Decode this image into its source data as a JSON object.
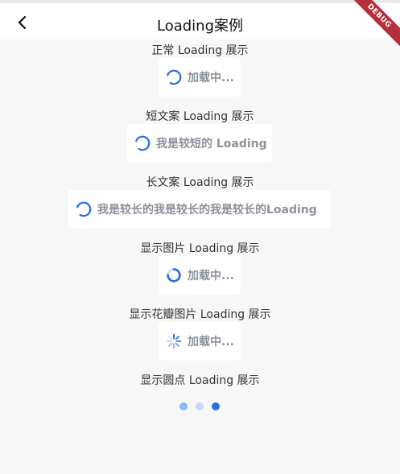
{
  "appbar": {
    "title": "Loading案例",
    "back_icon": "chevron-left-icon"
  },
  "debug_banner": "DEBUG",
  "sections": [
    {
      "label": "正常 Loading 展示",
      "text": "加载中..."
    },
    {
      "label": "短文案 Loading 展示",
      "text": "我是较短的 Loading"
    },
    {
      "label": "长文案 Loading 展示",
      "text": "我是较长的我是较长的我是较长的Loading"
    },
    {
      "label": "显示图片 Loading 展示",
      "text": "加载中..."
    },
    {
      "label": "显示花瓣图片 Loading 展示",
      "text": "加载中..."
    },
    {
      "label": "显示圆点 Loading 展示"
    }
  ],
  "colors": {
    "accent": "#2a6ee8",
    "accent_light": "#c7dafc",
    "accent_mid": "#8fb6f4",
    "text_muted": "#8c929a"
  }
}
